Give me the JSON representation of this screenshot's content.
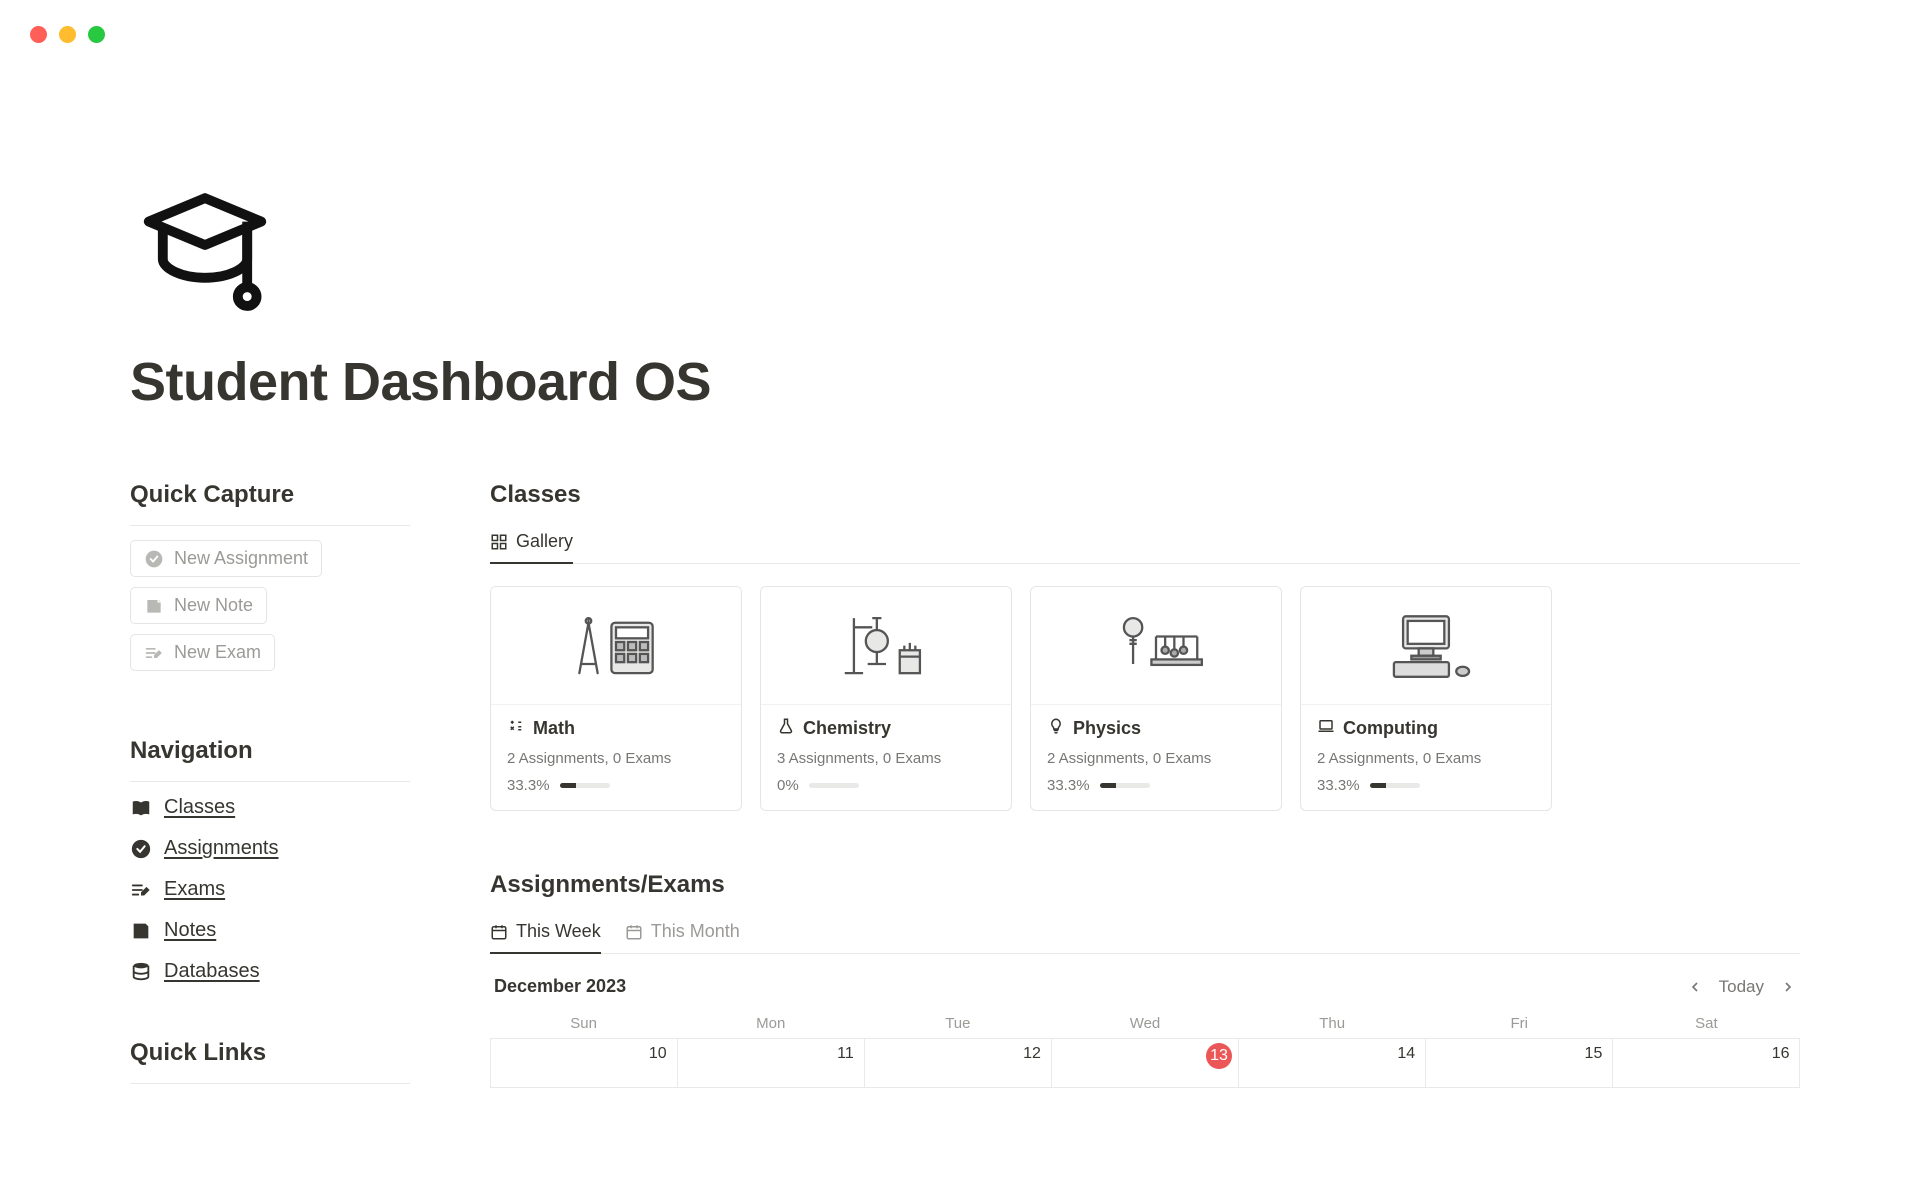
{
  "page_title": "Student Dashboard OS",
  "sidebar": {
    "quick_capture": {
      "heading": "Quick Capture",
      "items": [
        "New Assignment",
        "New Note",
        "New Exam"
      ]
    },
    "navigation": {
      "heading": "Navigation",
      "items": [
        "Classes",
        "Assignments",
        "Exams",
        "Notes",
        "Databases"
      ]
    },
    "quick_links": {
      "heading": "Quick Links"
    }
  },
  "classes": {
    "heading": "Classes",
    "view_label": "Gallery",
    "cards": [
      {
        "title": "Math",
        "meta": "2 Assignments, 0 Exams",
        "pct": "33.3%",
        "fill": 33.3,
        "icon": "math"
      },
      {
        "title": "Chemistry",
        "meta": "3 Assignments, 0 Exams",
        "pct": "0%",
        "fill": 0,
        "icon": "flask"
      },
      {
        "title": "Physics",
        "meta": "2 Assignments, 0 Exams",
        "pct": "33.3%",
        "fill": 33.3,
        "icon": "bulb"
      },
      {
        "title": "Computing",
        "meta": "2 Assignments, 0 Exams",
        "pct": "33.3%",
        "fill": 33.3,
        "icon": "laptop"
      }
    ]
  },
  "assignments_exams": {
    "heading": "Assignments/Exams",
    "tabs": [
      "This Week",
      "This Month"
    ],
    "active_tab": 0,
    "month_label": "December 2023",
    "today_label": "Today",
    "dow": [
      "Sun",
      "Mon",
      "Tue",
      "Wed",
      "Thu",
      "Fri",
      "Sat"
    ],
    "days": [
      10,
      11,
      12,
      13,
      14,
      15,
      16
    ],
    "today_index": 3
  }
}
